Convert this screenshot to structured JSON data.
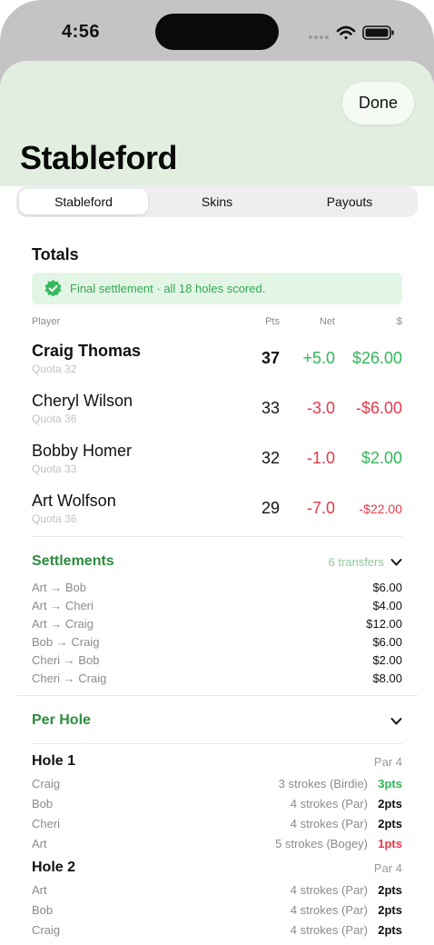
{
  "status_bar": {
    "time": "4:56"
  },
  "header": {
    "done_label": "Done",
    "title": "Stableford"
  },
  "tabs": [
    {
      "label": "Stableford",
      "selected": true
    },
    {
      "label": "Skins",
      "selected": false
    },
    {
      "label": "Payouts",
      "selected": false
    }
  ],
  "totals": {
    "heading": "Totals",
    "banner": "Final settlement · all 18 holes scored.",
    "columns": {
      "player": "Player",
      "pts": "Pts",
      "net": "Net",
      "money": "$"
    },
    "players": [
      {
        "name": "Craig Thomas",
        "quota": "Quota 32",
        "pts": "37",
        "net": "+5.0",
        "money": "$26.00"
      },
      {
        "name": "Cheryl Wilson",
        "quota": "Quota 36",
        "pts": "33",
        "net": "-3.0",
        "money": "-$6.00"
      },
      {
        "name": "Bobby Homer",
        "quota": "Quota 33",
        "pts": "32",
        "net": "-1.0",
        "money": "$2.00"
      },
      {
        "name": "Art Wolfson",
        "quota": "Quota 36",
        "pts": "29",
        "net": "-7.0",
        "money": "-$22.00"
      }
    ]
  },
  "settlements": {
    "title": "Settlements",
    "summary": "6 transfers",
    "items": [
      {
        "label": "Art → Bob",
        "amount": "$6.00"
      },
      {
        "label": "Art → Cheri",
        "amount": "$4.00"
      },
      {
        "label": "Art → Craig",
        "amount": "$12.00"
      },
      {
        "label": "Bob → Craig",
        "amount": "$6.00"
      },
      {
        "label": "Cheri → Bob",
        "amount": "$2.00"
      },
      {
        "label": "Cheri → Craig",
        "amount": "$8.00"
      }
    ]
  },
  "per_hole": {
    "title": "Per Hole",
    "holes": [
      {
        "name": "Hole 1",
        "par": "Par 4",
        "rows": [
          {
            "player": "Craig",
            "strokes": "3 strokes (Birdie)",
            "pts": "3pts"
          },
          {
            "player": "Bob",
            "strokes": "4 strokes (Par)",
            "pts": "2pts"
          },
          {
            "player": "Cheri",
            "strokes": "4 strokes (Par)",
            "pts": "2pts"
          },
          {
            "player": "Art",
            "strokes": "5 strokes (Bogey)",
            "pts": "1pts"
          }
        ]
      },
      {
        "name": "Hole 2",
        "par": "Par 4",
        "rows": [
          {
            "player": "Art",
            "strokes": "4 strokes (Par)",
            "pts": "2pts"
          },
          {
            "player": "Bob",
            "strokes": "4 strokes (Par)",
            "pts": "2pts"
          },
          {
            "player": "Craig",
            "strokes": "4 strokes (Par)",
            "pts": "2pts"
          }
        ]
      }
    ]
  },
  "colors": {
    "accent_green": "#2e8b3e",
    "positive": "#33b55a",
    "negative": "#e5394a",
    "header_bg": "#e2efe0"
  }
}
